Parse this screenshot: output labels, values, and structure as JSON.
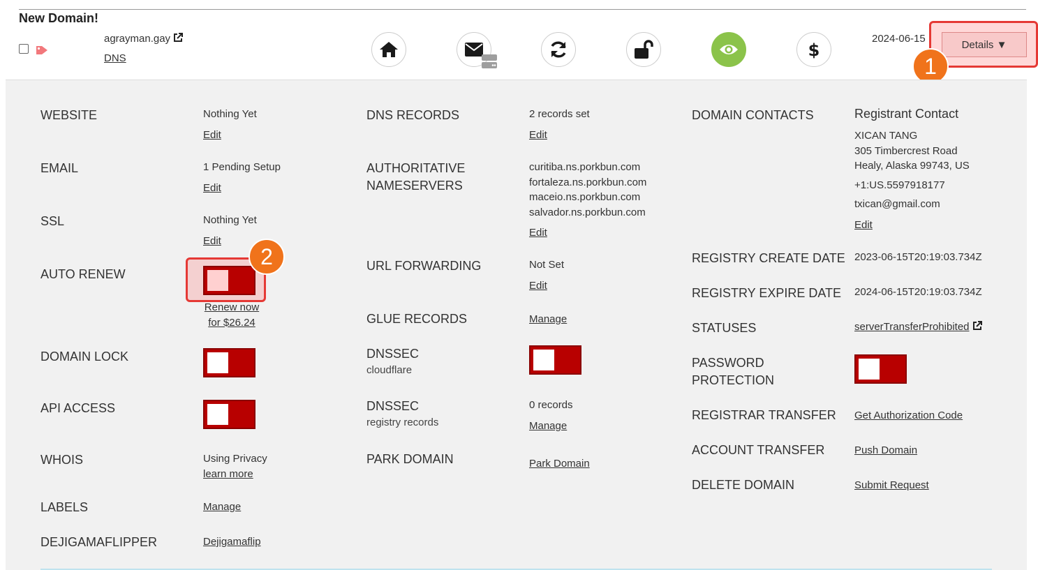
{
  "header": {
    "title": "New Domain!",
    "domain": "agrayman.gay",
    "dns_link": "DNS",
    "expire_date": "2024-06-15",
    "details_label": "Details ▼",
    "icons": [
      "home-icon",
      "email-server-icon",
      "refresh-icon",
      "unlock-icon",
      "eye-icon",
      "dollar-icon"
    ]
  },
  "callouts": {
    "one": "1",
    "two": "2"
  },
  "col1": {
    "website": {
      "label": "WEBSITE",
      "value": "Nothing Yet",
      "edit": "Edit"
    },
    "email": {
      "label": "EMAIL",
      "value": "1 Pending Setup",
      "edit": "Edit"
    },
    "ssl": {
      "label": "SSL",
      "value": "Nothing Yet",
      "edit": "Edit"
    },
    "auto_renew": {
      "label": "AUTO RENEW",
      "renew_line1": "Renew now",
      "renew_line2": "for $26.24"
    },
    "domain_lock": {
      "label": "DOMAIN LOCK"
    },
    "api_access": {
      "label": "API ACCESS"
    },
    "whois": {
      "label": "WHOIS",
      "value": "Using Privacy",
      "link": "learn more"
    },
    "labels": {
      "label": "LABELS",
      "link": "Manage"
    },
    "flipper": {
      "label": "DEJIGAMAFLIPPER",
      "link": "Dejigamaflip"
    }
  },
  "col2": {
    "dns_records": {
      "label": "DNS RECORDS",
      "value": "2 records set",
      "edit": "Edit"
    },
    "nameservers": {
      "label_line1": "AUTHORITATIVE",
      "label_line2": "NAMESERVERS",
      "servers": [
        "curitiba.ns.porkbun.com",
        "fortaleza.ns.porkbun.com",
        "maceio.ns.porkbun.com",
        "salvador.ns.porkbun.com"
      ],
      "edit": "Edit"
    },
    "url_forwarding": {
      "label": "URL FORWARDING",
      "value": "Not Set",
      "edit": "Edit"
    },
    "glue_records": {
      "label": "GLUE RECORDS",
      "link": "Manage"
    },
    "dnssec_cf": {
      "label": "DNSSEC",
      "sub": "cloudflare"
    },
    "dnssec_reg": {
      "label": "DNSSEC",
      "sub": "registry records",
      "value": "0 records",
      "link": "Manage"
    },
    "park": {
      "label": "PARK DOMAIN",
      "link": "Park Domain"
    }
  },
  "col3": {
    "contacts": {
      "label": "DOMAIN CONTACTS",
      "title": "Registrant Contact",
      "name": "XICAN TANG",
      "street": "305 Timbercrest Road",
      "city": "Healy, Alaska 99743, US",
      "phone": "+1:US.5597918177",
      "email": "txican@gmail.com",
      "edit": "Edit"
    },
    "create_date": {
      "label": "REGISTRY CREATE DATE",
      "value": "2023-06-15T20:19:03.734Z"
    },
    "expire_date": {
      "label": "REGISTRY EXPIRE DATE",
      "value": "2024-06-15T20:19:03.734Z"
    },
    "statuses": {
      "label": "STATUSES",
      "link": "serverTransferProhibited"
    },
    "password": {
      "label_line1": "PASSWORD",
      "label_line2": "PROTECTION"
    },
    "registrar_transfer": {
      "label": "REGISTRAR TRANSFER",
      "link": "Get Authorization Code"
    },
    "account_transfer": {
      "label": "ACCOUNT TRANSFER",
      "link": "Push Domain"
    },
    "delete": {
      "label": "DELETE DOMAIN",
      "link": "Submit Request"
    }
  },
  "colors": {
    "toggle_red": "#b80000",
    "callout_orange": "#f0731b",
    "highlight_red": "#e53935",
    "eye_green": "#8bc34a"
  }
}
